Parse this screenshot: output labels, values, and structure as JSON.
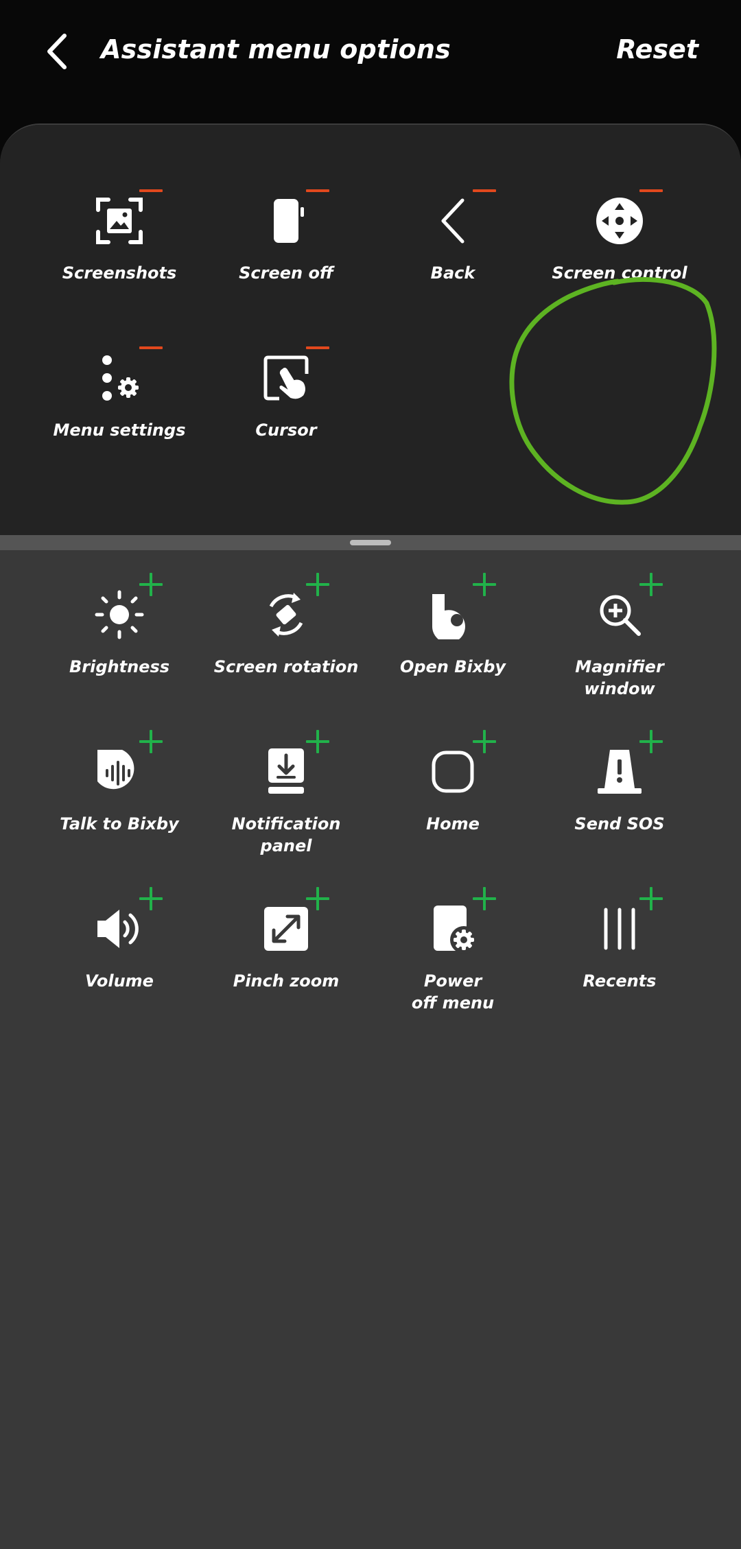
{
  "header": {
    "title": "Assistant menu options",
    "reset_label": "Reset"
  },
  "colors": {
    "remove": "#e2481d",
    "add": "#21b24a",
    "annotation": "#5db322"
  },
  "selected_items": [
    {
      "id": "screenshots",
      "label": "Screenshots",
      "icon": "screenshot-icon"
    },
    {
      "id": "screen-off",
      "label": "Screen off",
      "icon": "phone-icon"
    },
    {
      "id": "back",
      "label": "Back",
      "icon": "chevron-left-icon"
    },
    {
      "id": "screen-control",
      "label": "Screen control",
      "icon": "move-control-icon"
    },
    {
      "id": "menu-settings",
      "label": "Menu settings",
      "icon": "menu-settings-icon"
    },
    {
      "id": "cursor",
      "label": "Cursor",
      "icon": "cursor-icon"
    }
  ],
  "available_items": [
    {
      "id": "brightness",
      "label": "Brightness",
      "icon": "sun-icon"
    },
    {
      "id": "screen-rotation",
      "label": "Screen rotation",
      "icon": "rotate-icon"
    },
    {
      "id": "open-bixby",
      "label": "Open Bixby",
      "icon": "bixby-icon"
    },
    {
      "id": "magnifier-window",
      "label": "Magnifier window",
      "icon": "magnifier-icon"
    },
    {
      "id": "talk-to-bixby",
      "label": "Talk to Bixby",
      "icon": "bixby-voice-icon"
    },
    {
      "id": "notification-panel",
      "label": "Notification panel",
      "icon": "notification-panel-icon"
    },
    {
      "id": "home",
      "label": "Home",
      "icon": "home-icon"
    },
    {
      "id": "send-sos",
      "label": "Send SOS",
      "icon": "siren-icon"
    },
    {
      "id": "volume",
      "label": "Volume",
      "icon": "volume-icon"
    },
    {
      "id": "pinch-zoom",
      "label": "Pinch zoom",
      "icon": "expand-icon"
    },
    {
      "id": "power-off-menu",
      "label": "Power\noff menu",
      "icon": "power-settings-icon"
    },
    {
      "id": "recents",
      "label": "Recents",
      "icon": "recents-icon"
    }
  ]
}
